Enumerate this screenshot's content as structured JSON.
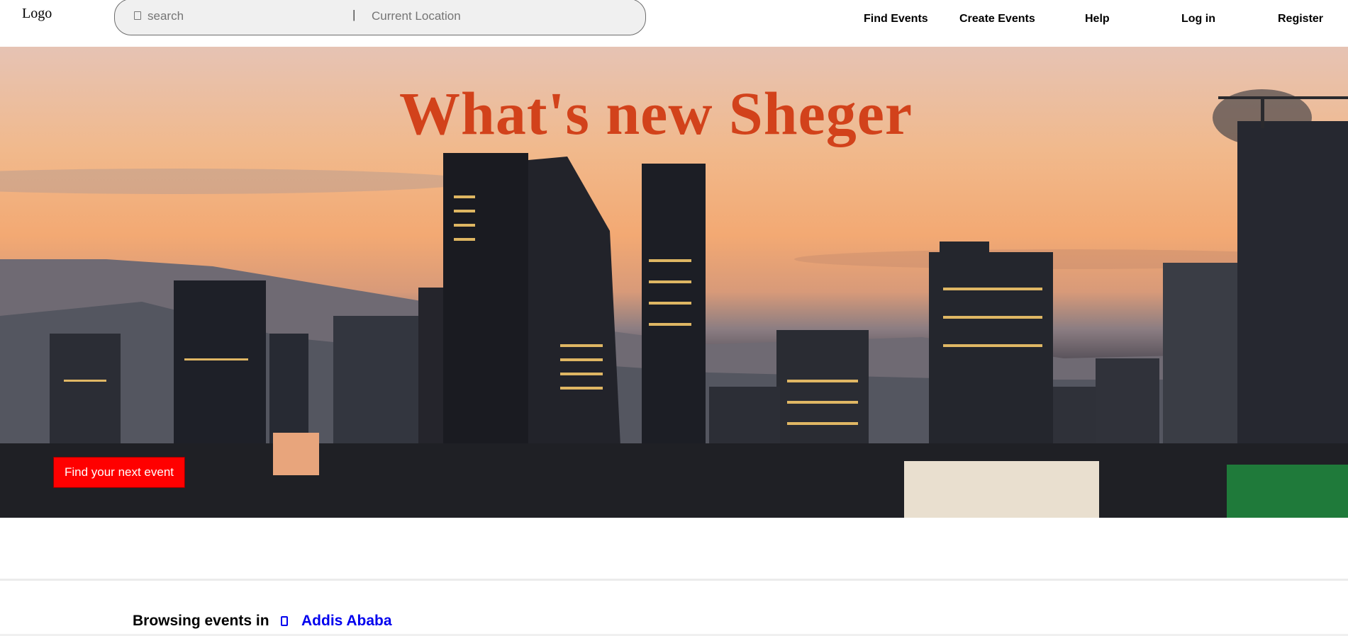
{
  "header": {
    "logo": "Logo",
    "search_placeholder": "search",
    "separator": "|",
    "location_placeholder": "Current Location",
    "nav": {
      "find_events": "Find Events",
      "create_events": "Create Events",
      "help": "Help",
      "log_in": "Log in",
      "register": "Register"
    }
  },
  "hero": {
    "title": "What's new Sheger",
    "cta_label": "Find your next event"
  },
  "browse": {
    "label": "Browsing events in",
    "city": "Addis Ababa"
  },
  "colors": {
    "title": "#d2421b",
    "cta_bg": "#ff0000",
    "link": "#0000ee"
  },
  "icons": {
    "search": "search-icon",
    "location": "location-pin-icon"
  }
}
